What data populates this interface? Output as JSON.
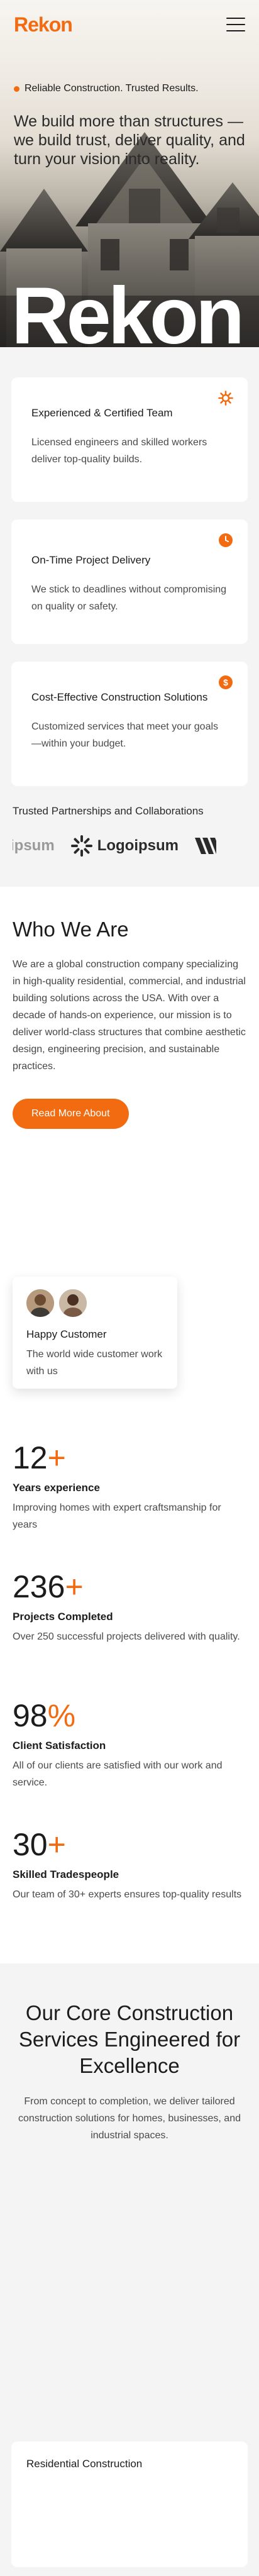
{
  "brand": {
    "logo": "Rekon",
    "big_word": "Rekon",
    "accent": "#f26b10"
  },
  "hero": {
    "tagline": "Reliable Construction. Trusted Results.",
    "headline": "We build more than structures — we build trust, deliver quality, and turn your vision into reality."
  },
  "features": [
    {
      "title": "Experienced & Certified Team",
      "text": "Licensed engineers and skilled workers deliver top-quality builds.",
      "icon": "gear-icon"
    },
    {
      "title": "On-Time Project Delivery",
      "text": "We stick to deadlines without compromising on quality or safety.",
      "icon": "clock-icon"
    },
    {
      "title": "Cost-Effective Construction Solutions",
      "text": "Customized services that meet your goals—within your budget.",
      "icon": "dollar-icon"
    }
  ],
  "partners": {
    "title": "Trusted Partnerships and Collaborations",
    "logos": [
      "ipsum",
      "Logoipsum"
    ]
  },
  "about": {
    "title": "Who We Are",
    "text": "We are a global construction company specializing in high-quality residential, commercial, and industrial building solutions across the USA. With over a decade of hands-on experience, our mission is to deliver world-class structures that combine aesthetic design, engineering precision, and sustainable practices.",
    "button": "Read More About"
  },
  "review": {
    "title": "Happy Customer",
    "text": "The world wide customer work with us"
  },
  "stats": [
    {
      "value": "12",
      "suffix": "+",
      "title": "Years experience",
      "text": "Improving homes with expert craftsmanship for years"
    },
    {
      "value": "236",
      "suffix": "+",
      "title": "Projects Completed",
      "text": "Over 250 successful projects delivered with quality."
    },
    {
      "value": "98",
      "suffix": "%",
      "title": "Client Satisfaction",
      "text": "All of our clients are satisfied with our work and service."
    },
    {
      "value": "30",
      "suffix": "+",
      "title": "Skilled Tradespeople",
      "text": "Our team of 30+ experts ensures top-quality results"
    }
  ],
  "services": {
    "title": "Our Core Construction Services Engineered for Excellence",
    "text": "From concept to completion, we deliver tailored construction solutions for homes, businesses, and industrial spaces.",
    "first_card": "Residential Construction"
  }
}
